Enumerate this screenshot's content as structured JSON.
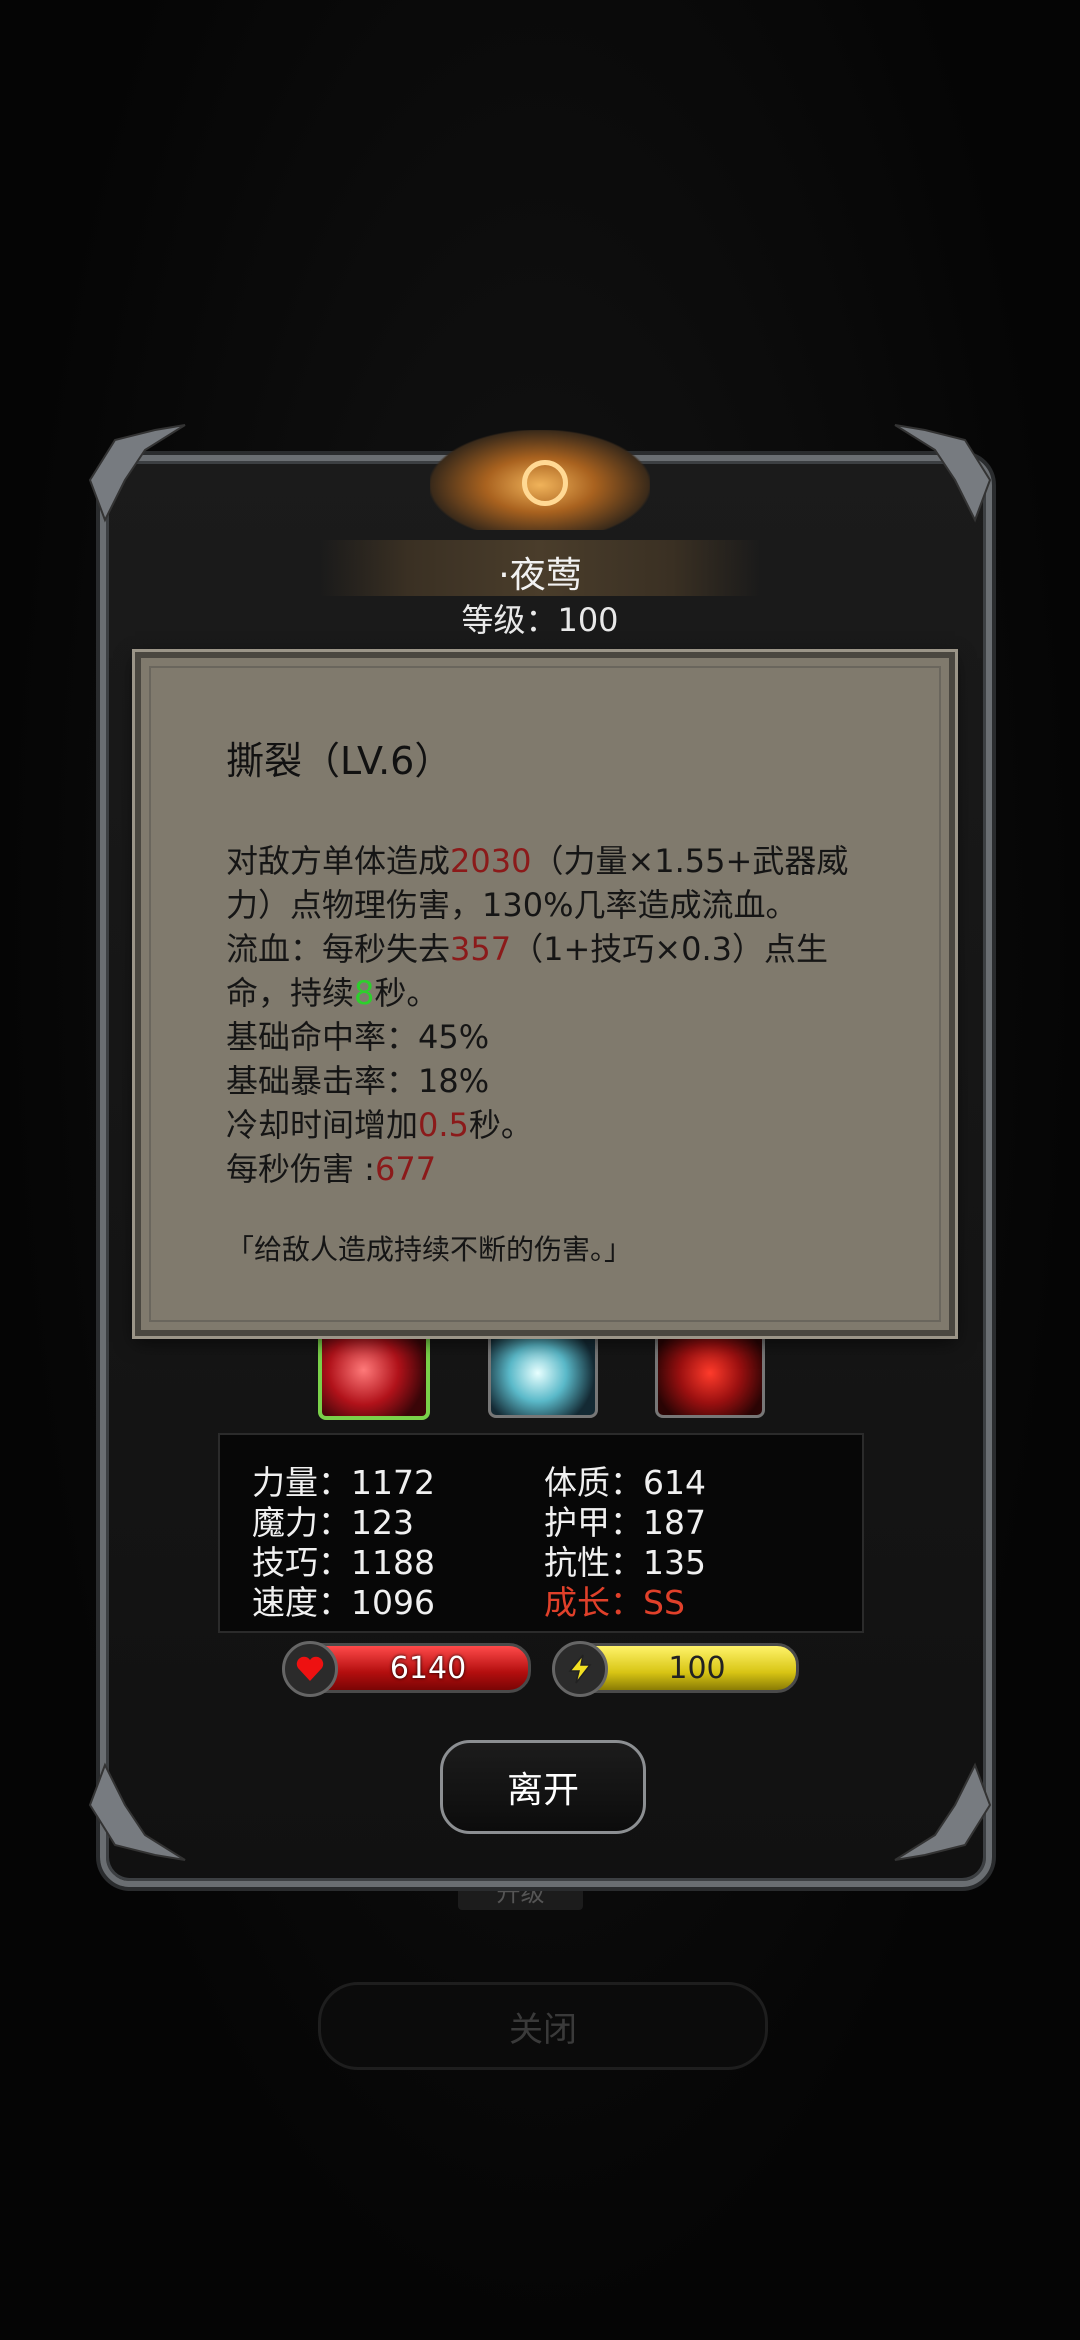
{
  "background": {
    "title": "",
    "close_label": "关闭",
    "subtab_label": "升级"
  },
  "character": {
    "name": "·夜莺",
    "level_text": "等级：100"
  },
  "skill_tooltip": {
    "title": "撕裂（LV.6）",
    "lines": [
      {
        "pre": "对敌方单体造成",
        "hl": "2030",
        "post": "（力量×1.55+武器威"
      },
      {
        "pre": "力）点物理伤害，130%几率造成流血。",
        "hl": "",
        "post": ""
      },
      {
        "pre": "流血：每秒失去",
        "hl": "357",
        "post": "（1+技巧×0.3）点生"
      },
      {
        "pre": "命，持续",
        "hl": "8",
        "post": "秒。"
      },
      {
        "pre": "基础命中率：45%",
        "hl": "",
        "post": ""
      },
      {
        "pre": "基础暴击率：18%",
        "hl": "",
        "post": ""
      },
      {
        "pre": "冷却时间增加",
        "hl": "0.5",
        "post": "秒。"
      },
      {
        "pre": "每秒伤害 :",
        "hl": "677",
        "post": ""
      }
    ],
    "quote": "「给敌人造成持续不断的伤害。」",
    "colors": {
      "highlight_red": "#8b1a1a",
      "highlight_green": "#2dcf2d"
    }
  },
  "skills": [
    {
      "name": "tear-skill-icon",
      "selected": true
    },
    {
      "name": "frost-skill-icon",
      "selected": false
    },
    {
      "name": "blood-skill-icon",
      "selected": false
    }
  ],
  "stats": {
    "strength": "力量：1172",
    "magic": "魔力：123",
    "skill": "技巧：1188",
    "speed": "速度：1096",
    "constitution": "体质：614",
    "armor": "护甲：187",
    "resistance": "抗性：135",
    "growth": "成长：SS"
  },
  "hp": {
    "value": "6140",
    "color": "#d11a1a"
  },
  "energy": {
    "value": "100",
    "color": "#e3d21a"
  },
  "leave_label": "离开"
}
